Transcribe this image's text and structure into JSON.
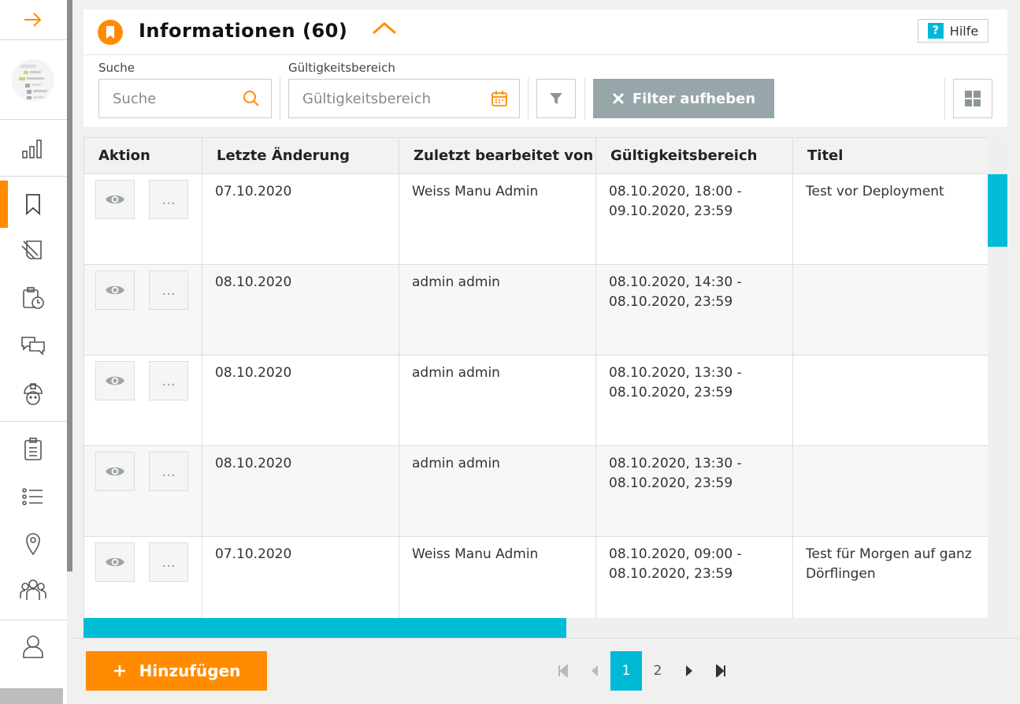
{
  "sidebar": {
    "items": [
      {
        "name": "arrow-right-icon"
      },
      {
        "name": "bar-chart-icon"
      },
      {
        "name": "bookmark-icon"
      },
      {
        "name": "document-edit-icon"
      },
      {
        "name": "clipboard-clock-icon"
      },
      {
        "name": "chat-bubbles-icon"
      },
      {
        "name": "worker-helmet-icon"
      },
      {
        "name": "clipboard-list-icon"
      },
      {
        "name": "list-icon"
      },
      {
        "name": "location-pin-icon"
      },
      {
        "name": "group-icon"
      },
      {
        "name": "user-icon"
      }
    ]
  },
  "header": {
    "title": "Informationen (60)",
    "help_label": "Hilfe",
    "help_icon_text": "?"
  },
  "filters": {
    "search_label": "Suche",
    "search_placeholder": "Suche",
    "validity_label": "Gültigkeitsbereich",
    "validity_placeholder": "Gültigkeitsbereich",
    "clear_label": "Filter aufheben"
  },
  "table": {
    "columns": [
      "Aktion",
      "Letzte Änderung",
      "Zuletzt bearbeitet von",
      "Gültigkeitsbereich",
      "Titel"
    ],
    "rows": [
      {
        "changed": "07.10.2020",
        "editor": "Weiss Manu Admin",
        "validity_from": "08.10.2020, 18:00 -",
        "validity_to": "09.10.2020, 23:59",
        "title": "Test vor Deployment"
      },
      {
        "changed": "08.10.2020",
        "editor": "admin admin",
        "validity_from": "08.10.2020, 14:30 -",
        "validity_to": "08.10.2020, 23:59",
        "title": ""
      },
      {
        "changed": "08.10.2020",
        "editor": "admin admin",
        "validity_from": "08.10.2020, 13:30 -",
        "validity_to": "08.10.2020, 23:59",
        "title": ""
      },
      {
        "changed": "08.10.2020",
        "editor": "admin admin",
        "validity_from": "08.10.2020, 13:30 -",
        "validity_to": "08.10.2020, 23:59",
        "title": ""
      },
      {
        "changed": "07.10.2020",
        "editor": "Weiss Manu Admin",
        "validity_from": "08.10.2020, 09:00 -",
        "validity_to": "08.10.2020, 23:59",
        "title": "Test für Morgen auf ganz Dörflingen"
      }
    ],
    "more_label": "..."
  },
  "footer": {
    "add_label": "Hinzufügen",
    "pages": [
      "1",
      "2"
    ],
    "current_page": "1"
  },
  "colors": {
    "accent": "#ff8c00",
    "teal": "#00b9d6",
    "clear_button": "#97a6a9"
  }
}
